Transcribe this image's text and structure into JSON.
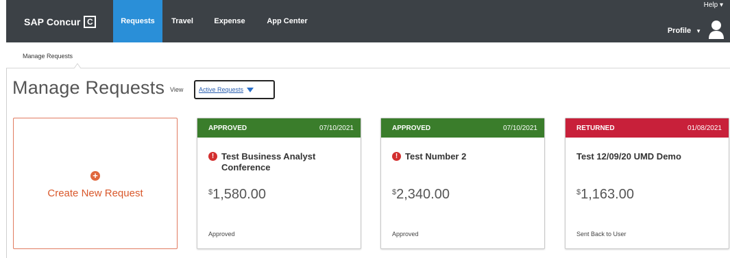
{
  "nav": {
    "brand": "SAP Concur",
    "brand_mark": "C",
    "tabs": [
      {
        "label": "Requests",
        "active": true
      },
      {
        "label": "Travel",
        "active": false
      },
      {
        "label": "Expense",
        "active": false
      },
      {
        "label": "App Center",
        "active": false
      }
    ],
    "help": "Help ▾",
    "profile": "Profile",
    "profile_caret": "▼",
    "avatar_icon": "user-silhouette-icon"
  },
  "subnav": {
    "item": "Manage Requests"
  },
  "page": {
    "title": "Manage Requests",
    "view_label": "View",
    "view_selected": "Active Requests"
  },
  "create_card": {
    "icon": "plus-circle-icon",
    "plus": "+",
    "label": "Create New Request"
  },
  "requests": [
    {
      "status": "APPROVED",
      "date": "07/10/2021",
      "header_color": "#3a7d2b",
      "alert": true,
      "alert_glyph": "!",
      "title": "Test Business Analyst Conference",
      "currency": "$",
      "amount": "1,580.00",
      "footer": "Approved"
    },
    {
      "status": "APPROVED",
      "date": "07/10/2021",
      "header_color": "#3a7d2b",
      "alert": true,
      "alert_glyph": "!",
      "title": "Test Number 2",
      "currency": "$",
      "amount": "2,340.00",
      "footer": "Approved"
    },
    {
      "status": "RETURNED",
      "date": "01/08/2021",
      "header_color": "#c8203a",
      "alert": false,
      "alert_glyph": "!",
      "title": "Test 12/09/20 UMD Demo",
      "currency": "$",
      "amount": "1,163.00",
      "footer": "Sent Back to User"
    }
  ]
}
